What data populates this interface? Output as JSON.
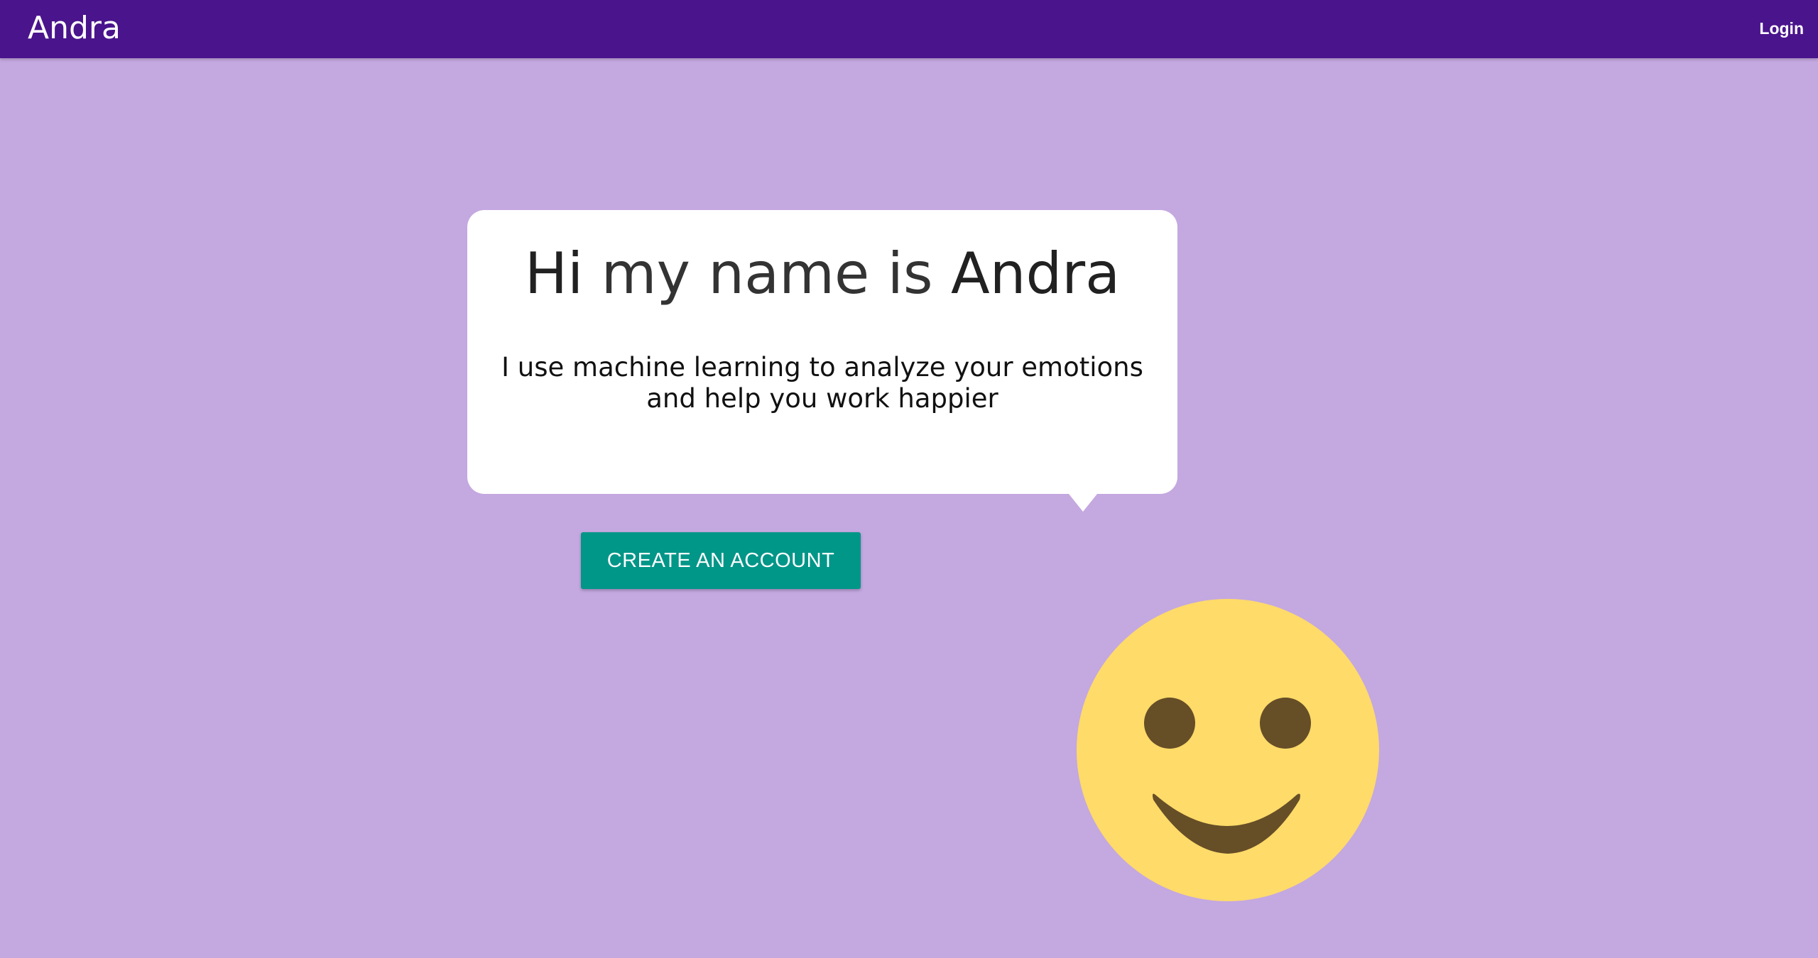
{
  "navbar": {
    "brand": "Andra",
    "login_label": "Login",
    "color": "#4a148c"
  },
  "hero": {
    "headline_word_1": "Hi",
    "headline_middle": " my name is ",
    "headline_word_2": "Andra",
    "subtitle_line_1": "I use machine learning to analyze your emotions",
    "subtitle_line_2": "and help you work happier"
  },
  "cta": {
    "label": "CREATE AN ACCOUNT",
    "color": "#009688"
  },
  "mascot": {
    "icon": "smiley-face-icon",
    "face_color": "#ffdb69",
    "feature_color": "#664e27"
  },
  "background_color": "#c4a8e0"
}
